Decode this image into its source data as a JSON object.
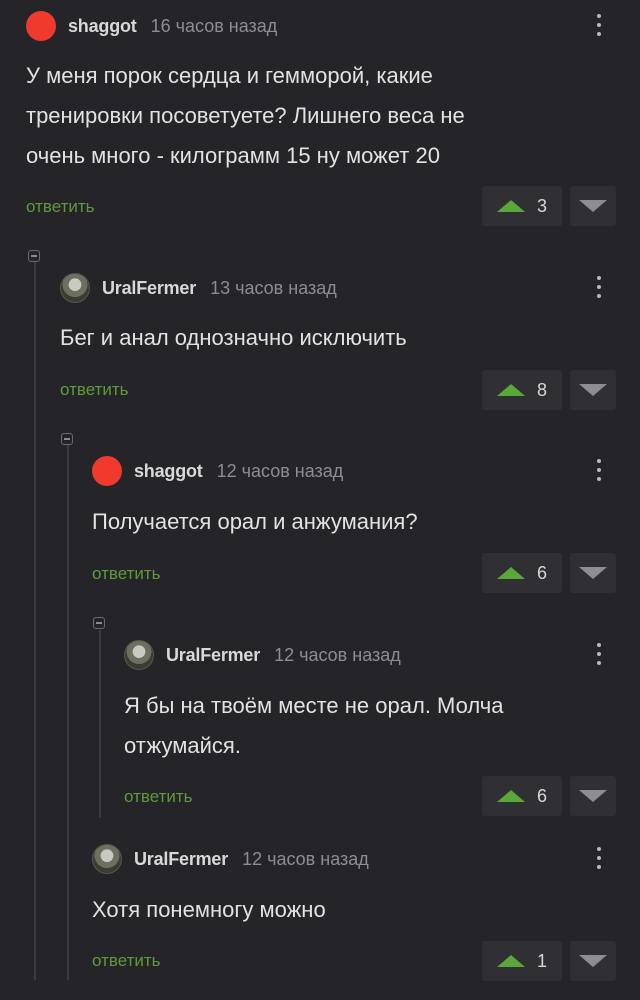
{
  "comments": [
    {
      "username": "shaggot",
      "time": "16 часов назад",
      "text_lines": [
        "У меня порок сердца и гемморой, какие",
        "тренировки посоветуете? Лишнего веса не",
        "очень много - килограмм 15 ну может 20"
      ],
      "reply": "ответить",
      "votes": "3"
    },
    {
      "username": "UralFermer",
      "time": "13 часов назад",
      "text_lines": [
        "Бег и анал однозначно исключить"
      ],
      "reply": "ответить",
      "votes": "8"
    },
    {
      "username": "shaggot",
      "time": "12 часов назад",
      "text_lines": [
        "Получается орал и анжумания?"
      ],
      "reply": "ответить",
      "votes": "6"
    },
    {
      "username": "UralFermer",
      "time": "12 часов назад",
      "text_lines": [
        "Я бы на твоём месте не орал. Молча",
        "отжумайся."
      ],
      "reply": "ответить",
      "votes": "6"
    },
    {
      "username": "UralFermer",
      "time": "12 часов назад",
      "text_lines": [
        "Хотя понемногу можно"
      ],
      "reply": "ответить",
      "votes": "1"
    }
  ]
}
